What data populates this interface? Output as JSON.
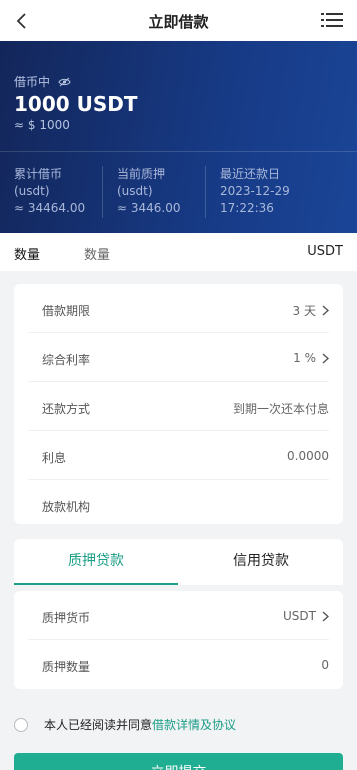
{
  "header": {
    "title": "立即借款",
    "back_icon": "chevron-left-icon",
    "menu_icon": "list-menu-icon"
  },
  "banner": {
    "status_label": "借币中",
    "amount": "1000 USDT",
    "approx_usd": "≈ $ 1000",
    "stats": [
      {
        "label": "累计借币",
        "unit": "(usdt)",
        "value": "≈ 34464.00"
      },
      {
        "label": "当前质押",
        "unit": "(usdt)",
        "value": "≈ 3446.00"
      },
      {
        "label": "最近还款日",
        "date": "2023-12-29",
        "time": "17:22:36"
      }
    ]
  },
  "quantity": {
    "label": "数量",
    "placeholder": "数量",
    "unit": "USDT"
  },
  "loan_details": [
    {
      "label": "借款期限",
      "value": "3 天",
      "has_chevron": true
    },
    {
      "label": "综合利率",
      "value": "1 %",
      "has_chevron": true
    },
    {
      "label": "还款方式",
      "value": "到期一次还本付息",
      "has_chevron": false
    },
    {
      "label": "利息",
      "value": "0.0000",
      "has_chevron": false
    },
    {
      "label": "放款机构",
      "value": "",
      "has_chevron": false
    }
  ],
  "tabs": [
    {
      "label": "质押贷款",
      "active": true
    },
    {
      "label": "信用贷款",
      "active": false
    }
  ],
  "pledge": [
    {
      "label": "质押货币",
      "value": "USDT",
      "has_chevron": true
    },
    {
      "label": "质押数量",
      "value": "0",
      "has_chevron": false
    }
  ],
  "agreement": {
    "text": "本人已经阅读并同意",
    "link": "借款详情及协议"
  },
  "submit_label": "立即提交",
  "colors": {
    "accent": "#1a9e86",
    "banner": "#173a85"
  }
}
